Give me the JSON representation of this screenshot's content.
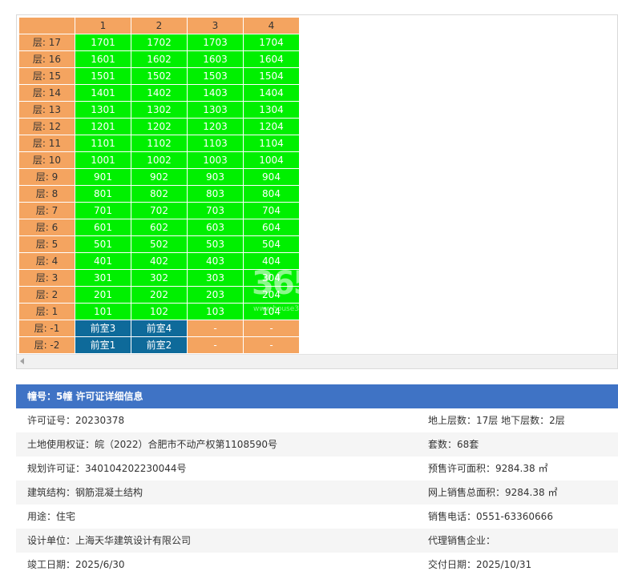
{
  "grid": {
    "columns": [
      "1",
      "2",
      "3",
      "4"
    ],
    "rows": [
      {
        "floor": "层: 17",
        "units": [
          "1701",
          "1702",
          "1703",
          "1704"
        ],
        "types": [
          "avail",
          "avail",
          "avail",
          "avail"
        ]
      },
      {
        "floor": "层: 16",
        "units": [
          "1601",
          "1602",
          "1603",
          "1604"
        ],
        "types": [
          "avail",
          "avail",
          "avail",
          "avail"
        ]
      },
      {
        "floor": "层: 15",
        "units": [
          "1501",
          "1502",
          "1503",
          "1504"
        ],
        "types": [
          "avail",
          "avail",
          "avail",
          "avail"
        ]
      },
      {
        "floor": "层: 14",
        "units": [
          "1401",
          "1402",
          "1403",
          "1404"
        ],
        "types": [
          "avail",
          "avail",
          "avail",
          "avail"
        ]
      },
      {
        "floor": "层: 13",
        "units": [
          "1301",
          "1302",
          "1303",
          "1304"
        ],
        "types": [
          "avail",
          "avail",
          "avail",
          "avail"
        ]
      },
      {
        "floor": "层: 12",
        "units": [
          "1201",
          "1202",
          "1203",
          "1204"
        ],
        "types": [
          "avail",
          "avail",
          "avail",
          "avail"
        ]
      },
      {
        "floor": "层: 11",
        "units": [
          "1101",
          "1102",
          "1103",
          "1104"
        ],
        "types": [
          "avail",
          "avail",
          "avail",
          "avail"
        ]
      },
      {
        "floor": "层: 10",
        "units": [
          "1001",
          "1002",
          "1003",
          "1004"
        ],
        "types": [
          "avail",
          "avail",
          "avail",
          "avail"
        ]
      },
      {
        "floor": "层: 9",
        "units": [
          "901",
          "902",
          "903",
          "904"
        ],
        "types": [
          "avail",
          "avail",
          "avail",
          "avail"
        ]
      },
      {
        "floor": "层: 8",
        "units": [
          "801",
          "802",
          "803",
          "804"
        ],
        "types": [
          "avail",
          "avail",
          "avail",
          "avail"
        ]
      },
      {
        "floor": "层: 7",
        "units": [
          "701",
          "702",
          "703",
          "704"
        ],
        "types": [
          "avail",
          "avail",
          "avail",
          "avail"
        ]
      },
      {
        "floor": "层: 6",
        "units": [
          "601",
          "602",
          "603",
          "604"
        ],
        "types": [
          "avail",
          "avail",
          "avail",
          "avail"
        ]
      },
      {
        "floor": "层: 5",
        "units": [
          "501",
          "502",
          "503",
          "504"
        ],
        "types": [
          "avail",
          "avail",
          "avail",
          "avail"
        ]
      },
      {
        "floor": "层: 4",
        "units": [
          "401",
          "402",
          "403",
          "404"
        ],
        "types": [
          "avail",
          "avail",
          "avail",
          "avail"
        ]
      },
      {
        "floor": "层: 3",
        "units": [
          "301",
          "302",
          "303",
          "304"
        ],
        "types": [
          "avail",
          "avail",
          "avail",
          "avail"
        ]
      },
      {
        "floor": "层: 2",
        "units": [
          "201",
          "202",
          "203",
          "204"
        ],
        "types": [
          "avail",
          "avail",
          "avail",
          "avail"
        ]
      },
      {
        "floor": "层: 1",
        "units": [
          "101",
          "102",
          "103",
          "104"
        ],
        "types": [
          "avail",
          "avail",
          "avail",
          "avail"
        ]
      },
      {
        "floor": "层: -1",
        "units": [
          "前室3",
          "前室4",
          "-",
          "-"
        ],
        "types": [
          "blue",
          "blue",
          "none",
          "none"
        ]
      },
      {
        "floor": "层: -2",
        "units": [
          "前室1",
          "前室2",
          "-",
          "-"
        ],
        "types": [
          "blue",
          "blue",
          "none",
          "none"
        ]
      }
    ],
    "colors": {
      "header": "#f4a460",
      "available": "#00f000",
      "blue": "#0e6a9a"
    }
  },
  "watermark": {
    "logo": "365",
    "url": "www.house365"
  },
  "info": {
    "title": "幢号：5幢 许可证详细信息",
    "rows": [
      {
        "left": "许可证号：20230378",
        "right": "地上层数：17层  地下层数：2层"
      },
      {
        "left": "土地使用权证：皖（2022）合肥市不动产权第1108590号",
        "right": "套数：68套"
      },
      {
        "left": "规划许可证：340104202230044号",
        "right": "预售许可面积：9284.38 ㎡"
      },
      {
        "left": "建筑结构：钢筋混凝土结构",
        "right": "网上销售总面积：9284.38 ㎡"
      },
      {
        "left": "用途：住宅",
        "right": "销售电话：0551-63360666"
      },
      {
        "left": "设计单位：上海天华建筑设计有限公司",
        "right": "代理销售企业："
      },
      {
        "left": "竣工日期：2025/6/30",
        "right": "交付日期：2025/10/31"
      }
    ]
  }
}
